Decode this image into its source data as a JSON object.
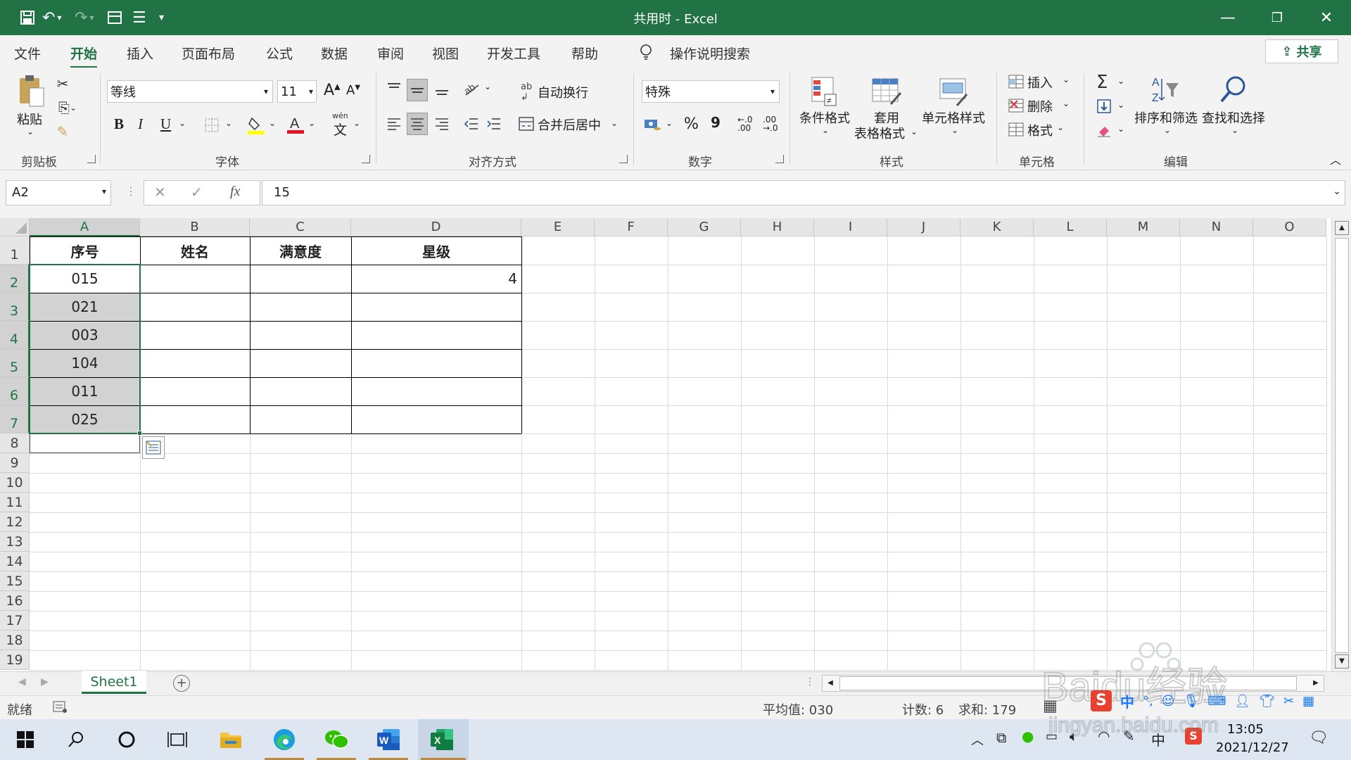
{
  "titlebar": {
    "title": "共用时  -  Excel",
    "minimize": "—",
    "restore": "❐",
    "close": "✕"
  },
  "menu": {
    "tabs": [
      "文件",
      "开始",
      "插入",
      "页面布局",
      "公式",
      "数据",
      "审阅",
      "视图",
      "开发工具",
      "帮助"
    ],
    "search": "操作说明搜索",
    "share": "共享"
  },
  "ribbon": {
    "clipboard": {
      "paste": "粘贴",
      "label": "剪贴板"
    },
    "font": {
      "name": "等线",
      "size": "11",
      "bold": "B",
      "italic": "I",
      "underline": "U",
      "grow": "A",
      "shrink": "A",
      "phonetic": "wén",
      "label": "字体"
    },
    "alignment": {
      "wrap": "自动换行",
      "merge": "合并后居中",
      "label": "对齐方式"
    },
    "number": {
      "format": "特殊",
      "percent": "%",
      "comma": "9",
      "label": "数字"
    },
    "styles": {
      "conditional": "条件格式",
      "table_1": "套用",
      "table_2": "表格格式",
      "cell_styles": "单元格样式",
      "label": "样式"
    },
    "cells": {
      "insert": "插入",
      "delete": "删除",
      "format": "格式",
      "label": "单元格"
    },
    "editing": {
      "sort": "排序和筛选",
      "find": "查找和选择",
      "sigma": "Σ",
      "label": "编辑"
    }
  },
  "formula_bar": {
    "name_box": "A2",
    "fx": "fx",
    "value": "15"
  },
  "sheet": {
    "columns": [
      "A",
      "B",
      "C",
      "D",
      "E",
      "F",
      "G",
      "H",
      "I",
      "J",
      "K",
      "L",
      "M",
      "N",
      "O"
    ],
    "rows": [
      "1",
      "2",
      "3",
      "4",
      "5",
      "6",
      "7",
      "8",
      "9",
      "10",
      "11",
      "12",
      "13",
      "14",
      "15",
      "16",
      "17",
      "18",
      "19"
    ],
    "headers": [
      "序号",
      "姓名",
      "满意度",
      "星级"
    ],
    "a_values": [
      "015",
      "021",
      "003",
      "104",
      "011",
      "025"
    ],
    "d2": "4"
  },
  "sheet_tab": "Sheet1",
  "status": {
    "ready": "就绪",
    "average": "平均值: 030",
    "count": "计数: 6",
    "sum": "求和: 179"
  },
  "taskbar": {
    "time": "13:05",
    "date": "2021/12/27",
    "ime": "中"
  },
  "watermark": {
    "text": "Baidu经验",
    "url": "jingyan.baidu.com"
  },
  "colors": {
    "excel_green": "#217346",
    "selection_gray": "#d2d2d2"
  }
}
